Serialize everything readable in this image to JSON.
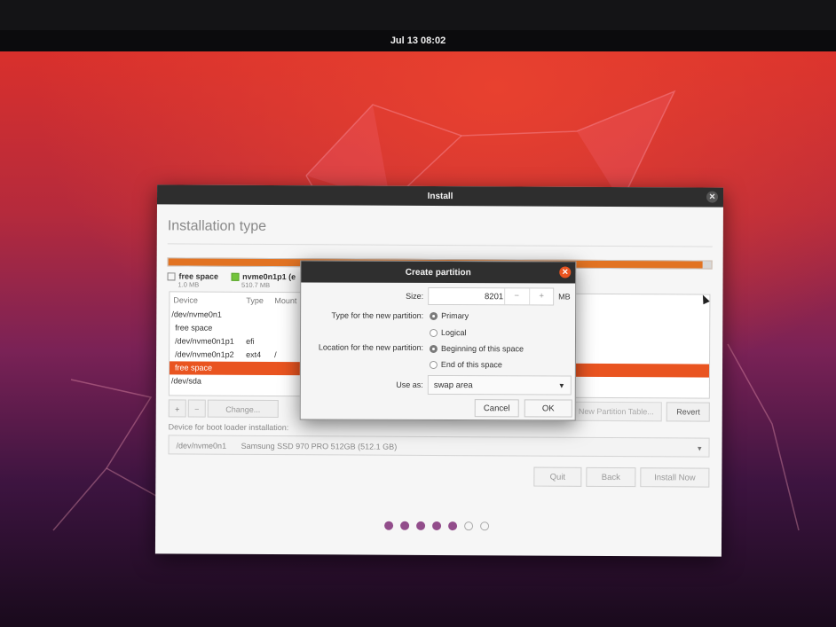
{
  "topbar": {
    "clock": "Jul 13  08:02"
  },
  "installer": {
    "window_title": "Install",
    "page_title": "Installation type",
    "legend": [
      {
        "name": "free space",
        "size": "1.0 MB",
        "color": "#ffffff"
      },
      {
        "name": "nvme0n1p1 (e",
        "size": "510.7 MB",
        "color": "#73c43b"
      }
    ],
    "table": {
      "headers": {
        "device": "Device",
        "type": "Type",
        "mount": "Mount"
      },
      "rows": [
        {
          "device": "/dev/nvme0n1",
          "type": "",
          "mount": ""
        },
        {
          "device": "free space",
          "type": "",
          "mount": ""
        },
        {
          "device": "/dev/nvme0n1p1",
          "type": "efi",
          "mount": ""
        },
        {
          "device": "/dev/nvme0n1p2",
          "type": "ext4",
          "mount": "/"
        },
        {
          "device": "free space",
          "type": "",
          "mount": ""
        },
        {
          "device": "/dev/sda",
          "type": "",
          "mount": ""
        }
      ]
    },
    "buttons": {
      "add": "+",
      "remove": "−",
      "change": "Change...",
      "new_table": "New Partition Table...",
      "revert": "Revert"
    },
    "boot_loader": {
      "label": "Device for boot loader installation:",
      "device": "/dev/nvme0n1",
      "description": "Samsung SSD 970 PRO 512GB (512.1 GB)"
    },
    "nav": {
      "quit": "Quit",
      "back": "Back",
      "install_now": "Install Now"
    },
    "progress": {
      "done": 5,
      "total": 7
    }
  },
  "dialog": {
    "title": "Create partition",
    "size_label": "Size:",
    "size_value": "8201",
    "minus": "−",
    "plus": "+",
    "unit": "MB",
    "type_label": "Type for the new partition:",
    "type_primary": "Primary",
    "type_logical": "Logical",
    "location_label": "Location for the new partition:",
    "loc_beginning": "Beginning of this space",
    "loc_end": "End of this space",
    "useas_label": "Use as:",
    "useas_value": "swap area",
    "cancel": "Cancel",
    "ok": "OK"
  },
  "colors": {
    "accent": "#e95420",
    "partition_bar": "#e27322",
    "progress_dot": "#924d8b"
  }
}
